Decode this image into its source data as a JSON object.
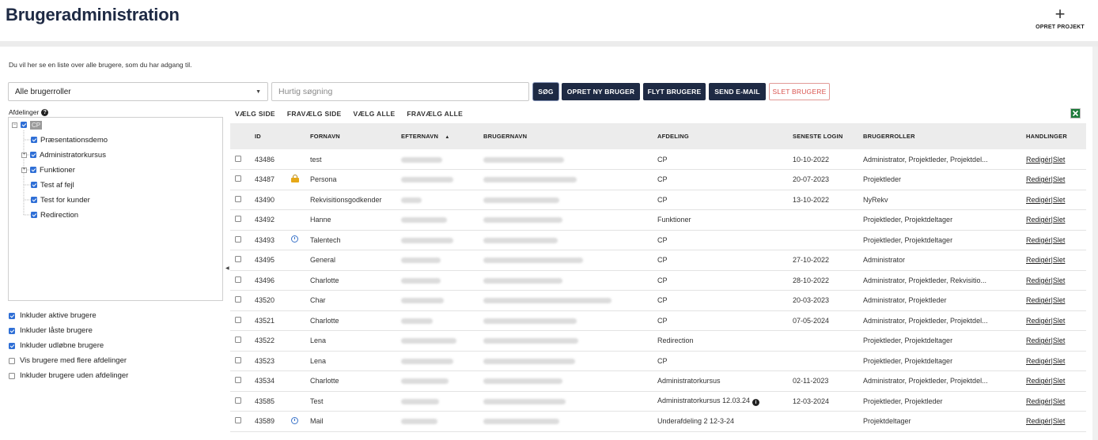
{
  "header": {
    "title": "Brugeradministration",
    "create_project_label": "OPRET PROJEKT",
    "plus_glyph": "+"
  },
  "intro_text": "Du vil her se en liste over alle brugere, som du har adgang til.",
  "filters": {
    "roles_selected": "Alle brugerroller",
    "search_placeholder": "Hurtig søgning"
  },
  "buttons": {
    "search": "SØG",
    "create_user": "OPRET NY BRUGER",
    "move_users": "FLYT BRUGERE",
    "send_email": "SEND E-MAIL",
    "delete_users": "SLET BRUGERE"
  },
  "departments": {
    "label": "Afdelinger",
    "root": "CP",
    "items": [
      "Præsentationsdemo",
      "Administratorkursus",
      "Funktioner",
      "Test af fejl",
      "Test for kunder",
      "Redirection"
    ]
  },
  "options": [
    {
      "label": "Inkluder aktive brugere",
      "checked": true
    },
    {
      "label": "Inkluder låste brugere",
      "checked": true
    },
    {
      "label": "Inkluder udløbne brugere",
      "checked": true
    },
    {
      "label": "Vis brugere med flere afdelinger",
      "checked": false
    },
    {
      "label": "Inkluder brugere uden afdelinger",
      "checked": false
    }
  ],
  "selection": {
    "select_page": "VÆLG SIDE",
    "deselect_page": "FRAVÆLG SIDE",
    "select_all": "VÆLG ALLE",
    "deselect_all": "FRAVÆLG ALLE"
  },
  "table": {
    "columns": [
      "ID",
      "FORNAVN",
      "EFTERNAVN",
      "BRUGERNAVN",
      "AFDELING",
      "SENESTE LOGIN",
      "BRUGERROLLER",
      "HANDLINGER"
    ],
    "sort_indicator": "▲",
    "edit_label": "Redigér",
    "separator": "|",
    "delete_label": "Slet",
    "rows": [
      {
        "id": "43486",
        "first": "test",
        "dept": "CP",
        "login": "10-10-2022",
        "roles": "Administrator, Projektleder, Projektdel...",
        "icon": ""
      },
      {
        "id": "43487",
        "first": "Persona",
        "dept": "CP",
        "login": "20-07-2023",
        "roles": "Projektleder",
        "icon": "lock-icon"
      },
      {
        "id": "43490",
        "first": "Rekvisitionsgodkender",
        "dept": "CP",
        "login": "13-10-2022",
        "roles": "NyRekv",
        "icon": ""
      },
      {
        "id": "43492",
        "first": "Hanne",
        "dept": "Funktioner",
        "login": "",
        "roles": "Projektleder, Projektdeltager",
        "icon": ""
      },
      {
        "id": "43493",
        "first": "Talentech",
        "dept": "CP",
        "login": "",
        "roles": "Projektleder, Projektdeltager",
        "icon": "timer-icon"
      },
      {
        "id": "43495",
        "first": "General",
        "dept": "CP",
        "login": "27-10-2022",
        "roles": "Administrator",
        "icon": ""
      },
      {
        "id": "43496",
        "first": "Charlotte",
        "dept": "CP",
        "login": "28-10-2022",
        "roles": "Administrator, Projektleder, Rekvisitio...",
        "icon": ""
      },
      {
        "id": "43520",
        "first": "Char",
        "dept": "CP",
        "login": "20-03-2023",
        "roles": "Administrator, Projektleder",
        "icon": ""
      },
      {
        "id": "43521",
        "first": "Charlotte",
        "dept": "CP",
        "login": "07-05-2024",
        "roles": "Administrator, Projektleder, Projektdel...",
        "icon": ""
      },
      {
        "id": "43522",
        "first": "Lena",
        "dept": "Redirection",
        "login": "",
        "roles": "Projektleder, Projektdeltager",
        "icon": ""
      },
      {
        "id": "43523",
        "first": "Lena",
        "dept": "CP",
        "login": "",
        "roles": "Projektleder, Projektdeltager",
        "icon": ""
      },
      {
        "id": "43534",
        "first": "Charlotte",
        "dept": "Administratorkursus",
        "login": "02-11-2023",
        "roles": "Administrator, Projektleder, Projektdel...",
        "icon": ""
      },
      {
        "id": "43585",
        "first": "Test",
        "dept": "Administratorkursus 12.03.24",
        "login": "12-03-2024",
        "roles": "Projektleder, Projektleder",
        "icon": "",
        "dept_info": true
      },
      {
        "id": "43589",
        "first": "Mail",
        "dept": "Underafdeling 2 12-3-24",
        "login": "",
        "roles": "Projektdeltager",
        "icon": "timer-icon"
      }
    ]
  }
}
